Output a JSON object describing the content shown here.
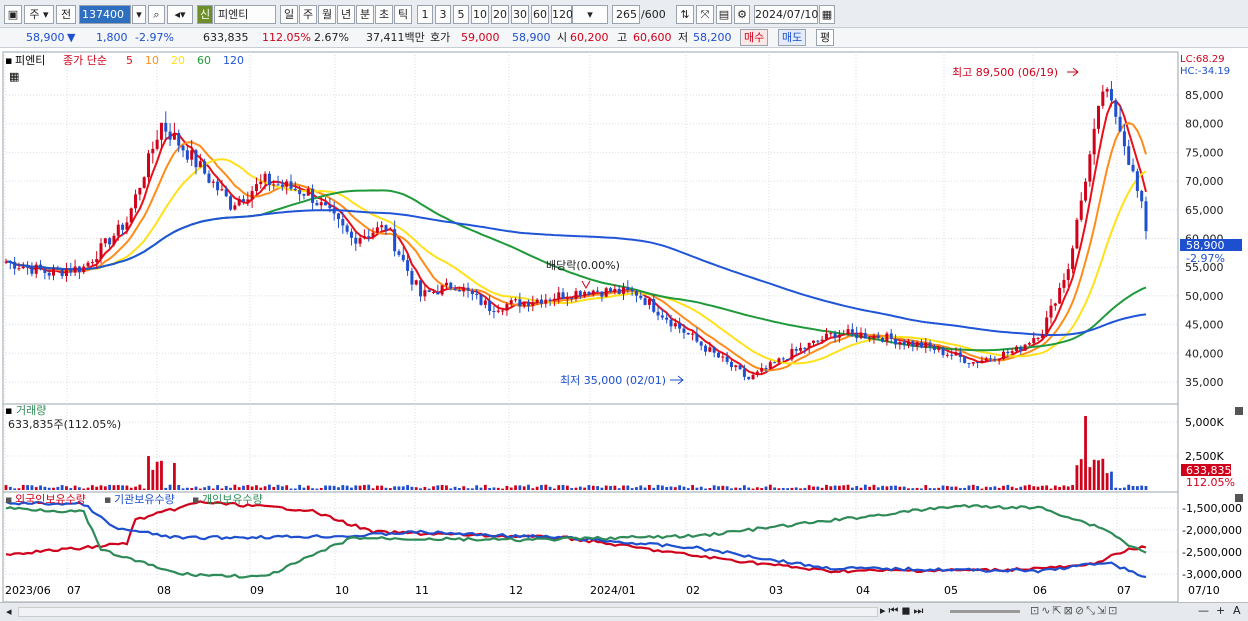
{
  "toolbar": {
    "mode1": "주",
    "mode2": "전",
    "code": "137400",
    "badge": "신",
    "name": "피엔티",
    "periods": [
      "일",
      "주",
      "월",
      "년",
      "분",
      "초",
      "틱"
    ],
    "nums": [
      "1",
      "3",
      "5",
      "10",
      "20",
      "30",
      "60",
      "120"
    ],
    "count": "265",
    "count_max": "/600",
    "date": "2024/07/10"
  },
  "quote": {
    "price": "58,900",
    "arrow": "▼",
    "change": "1,800",
    "pct": "-2.97%",
    "volume": "633,835",
    "vol_ratio": "112.05%",
    "turnover_pct": "2.67%",
    "amount": "37,411백만",
    "hoga_label": "호가",
    "ask": "59,000",
    "bid": "58,900",
    "open_label": "시",
    "open": "60,200",
    "high_label": "고",
    "high": "60,600",
    "low_label": "저",
    "low": "58,200",
    "buy": "매수",
    "sell": "매도",
    "even": "평"
  },
  "price_panel": {
    "name": "피엔티",
    "legend_prefix": "종가 단순",
    "ma": [
      "5",
      "10",
      "20",
      "60",
      "120"
    ],
    "ma_colors": [
      "#e8101a",
      "#ff8c1a",
      "#ffe11a",
      "#1f9a3a",
      "#1f55d6"
    ],
    "lc": "LC:68.29",
    "hc": "HC:-34.19",
    "max_label": "최고 89,500 (06/19)",
    "min_label": "최저 35,000 (02/01)",
    "div_label": "배당락(0.00%)",
    "cur_price": "58,900",
    "cur_pct": "-2.97%",
    "yticks": [
      "85,000",
      "80,000",
      "75,000",
      "70,000",
      "65,000",
      "60,000",
      "55,000",
      "50,000",
      "45,000",
      "40,000",
      "35,000"
    ]
  },
  "volume_panel": {
    "title": "거래량",
    "value": "633,835주(112.05%)",
    "yticks": [
      "5,000K",
      "2,500K"
    ],
    "cur": "633,835",
    "cur_pct": "112.05%"
  },
  "holding_panel": {
    "series": [
      "외국인보유수량",
      "기관보유수량",
      "개인보유수량"
    ],
    "colors": [
      "#d0021b",
      "#1d4fcf",
      "#2e8b57"
    ],
    "yticks": [
      "-1,500,000",
      "-2,000,000",
      "-2,500,000",
      "-3,000,000"
    ]
  },
  "xaxis": {
    "labels": [
      "2023/06",
      "07",
      "08",
      "09",
      "10",
      "11",
      "12",
      "2024/01",
      "02",
      "03",
      "04",
      "05",
      "06",
      "07"
    ],
    "end": "07/10"
  }
}
